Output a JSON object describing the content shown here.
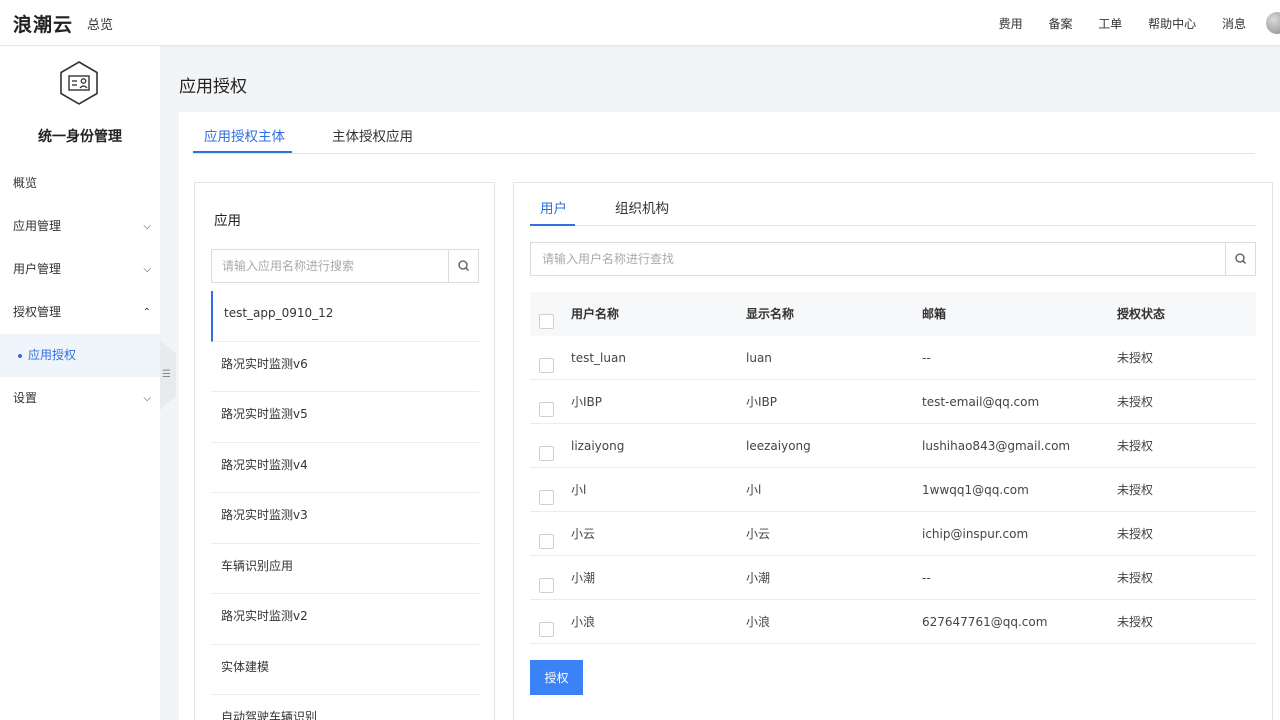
{
  "topbar": {
    "brand": "浪潮云",
    "overview": "总览",
    "links": [
      "费用",
      "备案",
      "工单",
      "帮助中心",
      "消息"
    ]
  },
  "sidebar": {
    "title": "统一身份管理",
    "items": [
      {
        "label": "概览",
        "chevron": ""
      },
      {
        "label": "应用管理",
        "chevron": "⌄"
      },
      {
        "label": "用户管理",
        "chevron": "⌄"
      },
      {
        "label": "授权管理",
        "chevron": "⌃"
      },
      {
        "label": "应用授权",
        "chevron": ""
      },
      {
        "label": "设置",
        "chevron": "⌄"
      }
    ]
  },
  "page": {
    "title": "应用授权",
    "tabs": [
      "应用授权主体",
      "主体授权应用"
    ]
  },
  "app_panel": {
    "title": "应用",
    "search_placeholder": "请输入应用名称进行搜索",
    "apps": [
      "test_app_0910_12",
      "路况实时监测v6",
      "路况实时监测v5",
      "路况实时监测v4",
      "路况实时监测v3",
      "车辆识别应用",
      "路况实时监测v2",
      "实体建模",
      "自动驾驶车辆识别"
    ]
  },
  "user_panel": {
    "tabs": [
      "用户",
      "组织机构"
    ],
    "search_placeholder": "请输入用户名称进行查找",
    "columns": [
      "用户名称",
      "显示名称",
      "邮箱",
      "授权状态"
    ],
    "rows": [
      {
        "username": "test_luan",
        "display": "luan",
        "email": "--",
        "status": "未授权"
      },
      {
        "username": "小IBP",
        "display": "小IBP",
        "email": "test-email@qq.com",
        "status": "未授权"
      },
      {
        "username": "lizaiyong",
        "display": "leezaiyong",
        "email": "lushihao843@gmail.com",
        "status": "未授权"
      },
      {
        "username": "小l",
        "display": "小l",
        "email": "1wwqq1@qq.com",
        "status": "未授权"
      },
      {
        "username": "小云",
        "display": "小云",
        "email": "ichip@inspur.com",
        "status": "未授权"
      },
      {
        "username": "小潮",
        "display": "小潮",
        "email": "--",
        "status": "未授权"
      },
      {
        "username": "小浪",
        "display": "小浪",
        "email": "627647761@qq.com",
        "status": "未授权"
      }
    ],
    "authorize_button": "授权"
  },
  "colors": {
    "accent": "#2f6fe0",
    "button": "#3b82f6"
  }
}
